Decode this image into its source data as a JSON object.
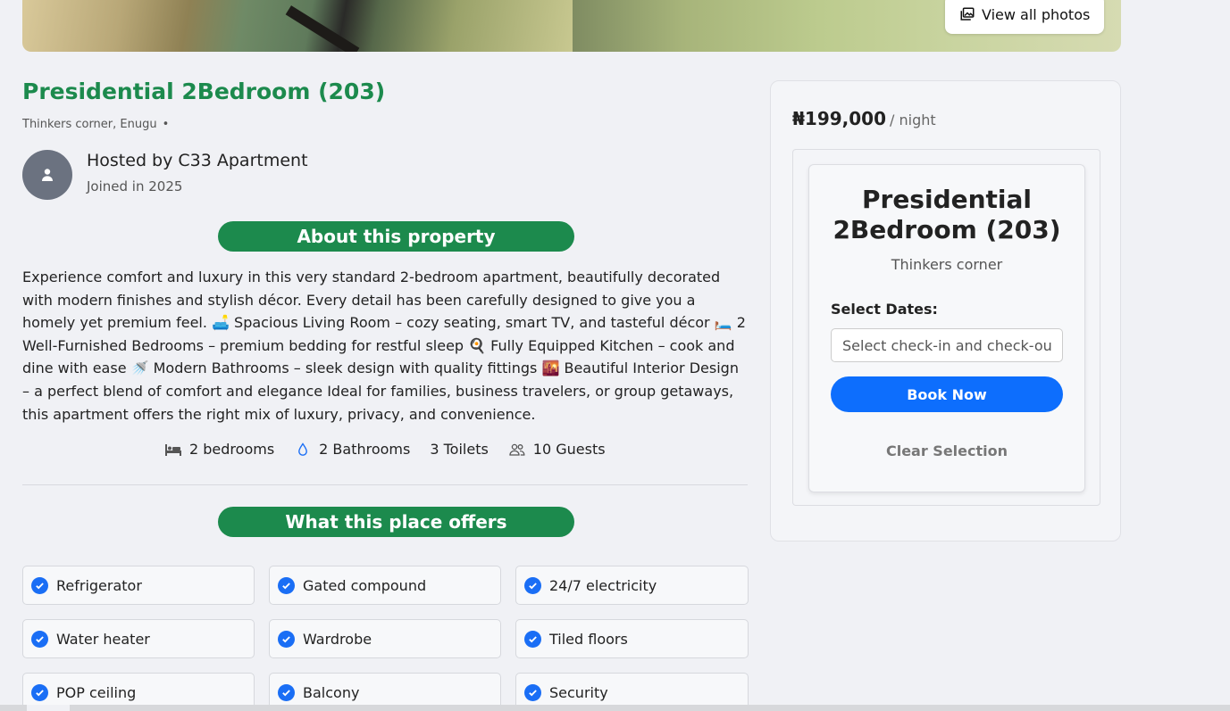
{
  "gallery": {
    "view_all_label": "View all photos",
    "icon": "photos-icon"
  },
  "property": {
    "title": "Presidential 2Bedroom (203)",
    "location": "Thinkers corner, Enugu",
    "location_separator": "•"
  },
  "host": {
    "name": "Hosted by C33 Apartment",
    "joined": "Joined in 2025",
    "avatar_icon": "user-icon"
  },
  "about": {
    "heading": "About this property",
    "description": "Experience comfort and luxury in this very standard 2-bedroom apartment, beautifully decorated with modern finishes and stylish décor. Every detail has been carefully designed to give you a homely yet premium feel. 🛋️ Spacious Living Room – cozy seating, smart TV, and tasteful décor 🛏️ 2 Well-Furnished Bedrooms – premium bedding for restful sleep 🍳 Fully Equipped Kitchen – cook and dine with ease 🚿 Modern Bathrooms – sleek design with quality fittings 🌇 Beautiful Interior Design – a perfect blend of comfort and elegance Ideal for families, business travelers, or group getaways, this apartment offers the right mix of luxury, privacy, and convenience."
  },
  "features": {
    "bedrooms": "2 bedrooms",
    "bathrooms": "2 Bathrooms",
    "toilets": "3 Toilets",
    "guests": "10 Guests"
  },
  "offers": {
    "heading": "What this place offers",
    "items": [
      "Refrigerator",
      "Gated compound",
      "24/7 electricity",
      "Water heater",
      "Wardrobe",
      "Tiled floors",
      "POP ceiling",
      "Balcony",
      "Security"
    ]
  },
  "booking": {
    "price": "₦199,000",
    "per_night": "/ night",
    "card_title": "Presidential 2Bedroom (203)",
    "card_location": "Thinkers corner",
    "select_dates_label": "Select Dates:",
    "date_placeholder": "Select check-in and check-out dates",
    "book_button": "Book Now",
    "clear_button": "Clear Selection"
  },
  "colors": {
    "brand_green": "#1c8a4d",
    "primary_blue": "#0d6efd",
    "check_blue": "#1a6ef5",
    "background": "#f0f1f5"
  }
}
